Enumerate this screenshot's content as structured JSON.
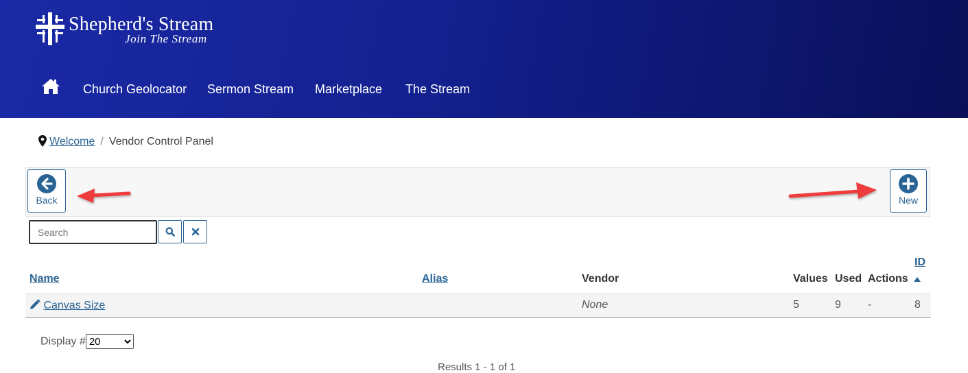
{
  "brand": {
    "title": "Shepherd's Stream",
    "tagline": "Join The Stream"
  },
  "nav": {
    "home_icon": "home-icon",
    "items": [
      "Church Geolocator",
      "Sermon Stream",
      "Marketplace",
      "The Stream"
    ]
  },
  "breadcrumb": {
    "icon": "map-marker-icon",
    "link": "Welcome",
    "separator": "/",
    "current": "Vendor Control Panel"
  },
  "toolbar": {
    "back_label": "Back",
    "back_icon": "arrow-circle-left-icon",
    "new_label": "New",
    "new_icon": "plus-circle-icon"
  },
  "search": {
    "placeholder": "Search",
    "value": "",
    "search_icon": "search-icon",
    "clear_icon": "close-icon"
  },
  "table": {
    "headers": {
      "name": "Name",
      "alias": "Alias",
      "vendor": "Vendor",
      "values": "Values",
      "used": "Used",
      "actions": "Actions",
      "id": "ID"
    },
    "rows": [
      {
        "name": "Canvas Size",
        "alias": "",
        "vendor": "None",
        "values": "5",
        "used": "9",
        "actions": "-",
        "id": "8"
      }
    ]
  },
  "pagination": {
    "display_label": "Display #",
    "display_value": "20",
    "results": "Results 1 - 1 of 1"
  },
  "colors": {
    "header_start": "#1a2aa6",
    "header_end": "#0a0f58",
    "link": "#2a6496",
    "arrow": "#ee3b3b"
  }
}
